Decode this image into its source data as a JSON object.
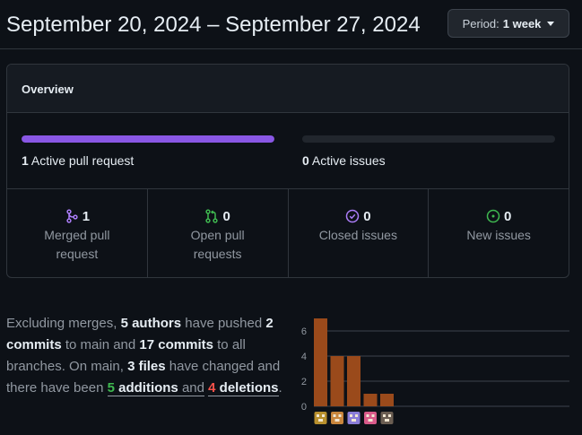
{
  "header": {
    "date_range": "September 20, 2024 – September 27, 2024",
    "period_label": "Period:",
    "period_value": "1 week"
  },
  "overview": {
    "title": "Overview",
    "pull_requests": {
      "count": "1",
      "label": "Active pull request",
      "fill_fraction": 1.0,
      "color": "#8957e5"
    },
    "issues": {
      "count": "0",
      "label": "Active issues",
      "fill_fraction": 0.0,
      "color": "#30363d"
    },
    "stats": [
      {
        "icon": "merged-pr-icon",
        "count": "1",
        "label": "Merged pull request",
        "color": "#ab7df8"
      },
      {
        "icon": "open-pr-icon",
        "count": "0",
        "label": "Open pull requests",
        "color": "#3fb950"
      },
      {
        "icon": "closed-issue-icon",
        "count": "0",
        "label": "Closed issues",
        "color": "#ab7df8"
      },
      {
        "icon": "new-issue-icon",
        "count": "0",
        "label": "New issues",
        "color": "#3fb950"
      }
    ]
  },
  "summary": {
    "t1": "Excluding merges,",
    "authors": "5 authors",
    "t2": "have pushed",
    "commits_main": "2 commits",
    "t3": "to main and",
    "commits_all": "17 commits",
    "t4": "to all branches. On main,",
    "files": "3 files",
    "t5": "have changed and there have been",
    "additions_num": "5",
    "additions_word": "additions",
    "t6": "and",
    "deletions_num": "4",
    "deletions_word": "deletions",
    "t7": "."
  },
  "chart_data": {
    "type": "bar",
    "categories": [
      "author 1",
      "author 2",
      "author 3",
      "author 4",
      "author 5"
    ],
    "values": [
      7,
      4,
      4,
      1,
      1
    ],
    "yticks": [
      "0",
      "2",
      "4",
      "6"
    ],
    "ylim": [
      0,
      7
    ],
    "bar_color": "#9a4a1b",
    "grid": true,
    "avatar_colors": [
      "#b8902e",
      "#c9863d",
      "#8a7dd8",
      "#d85a8a",
      "#6b5e52"
    ]
  }
}
